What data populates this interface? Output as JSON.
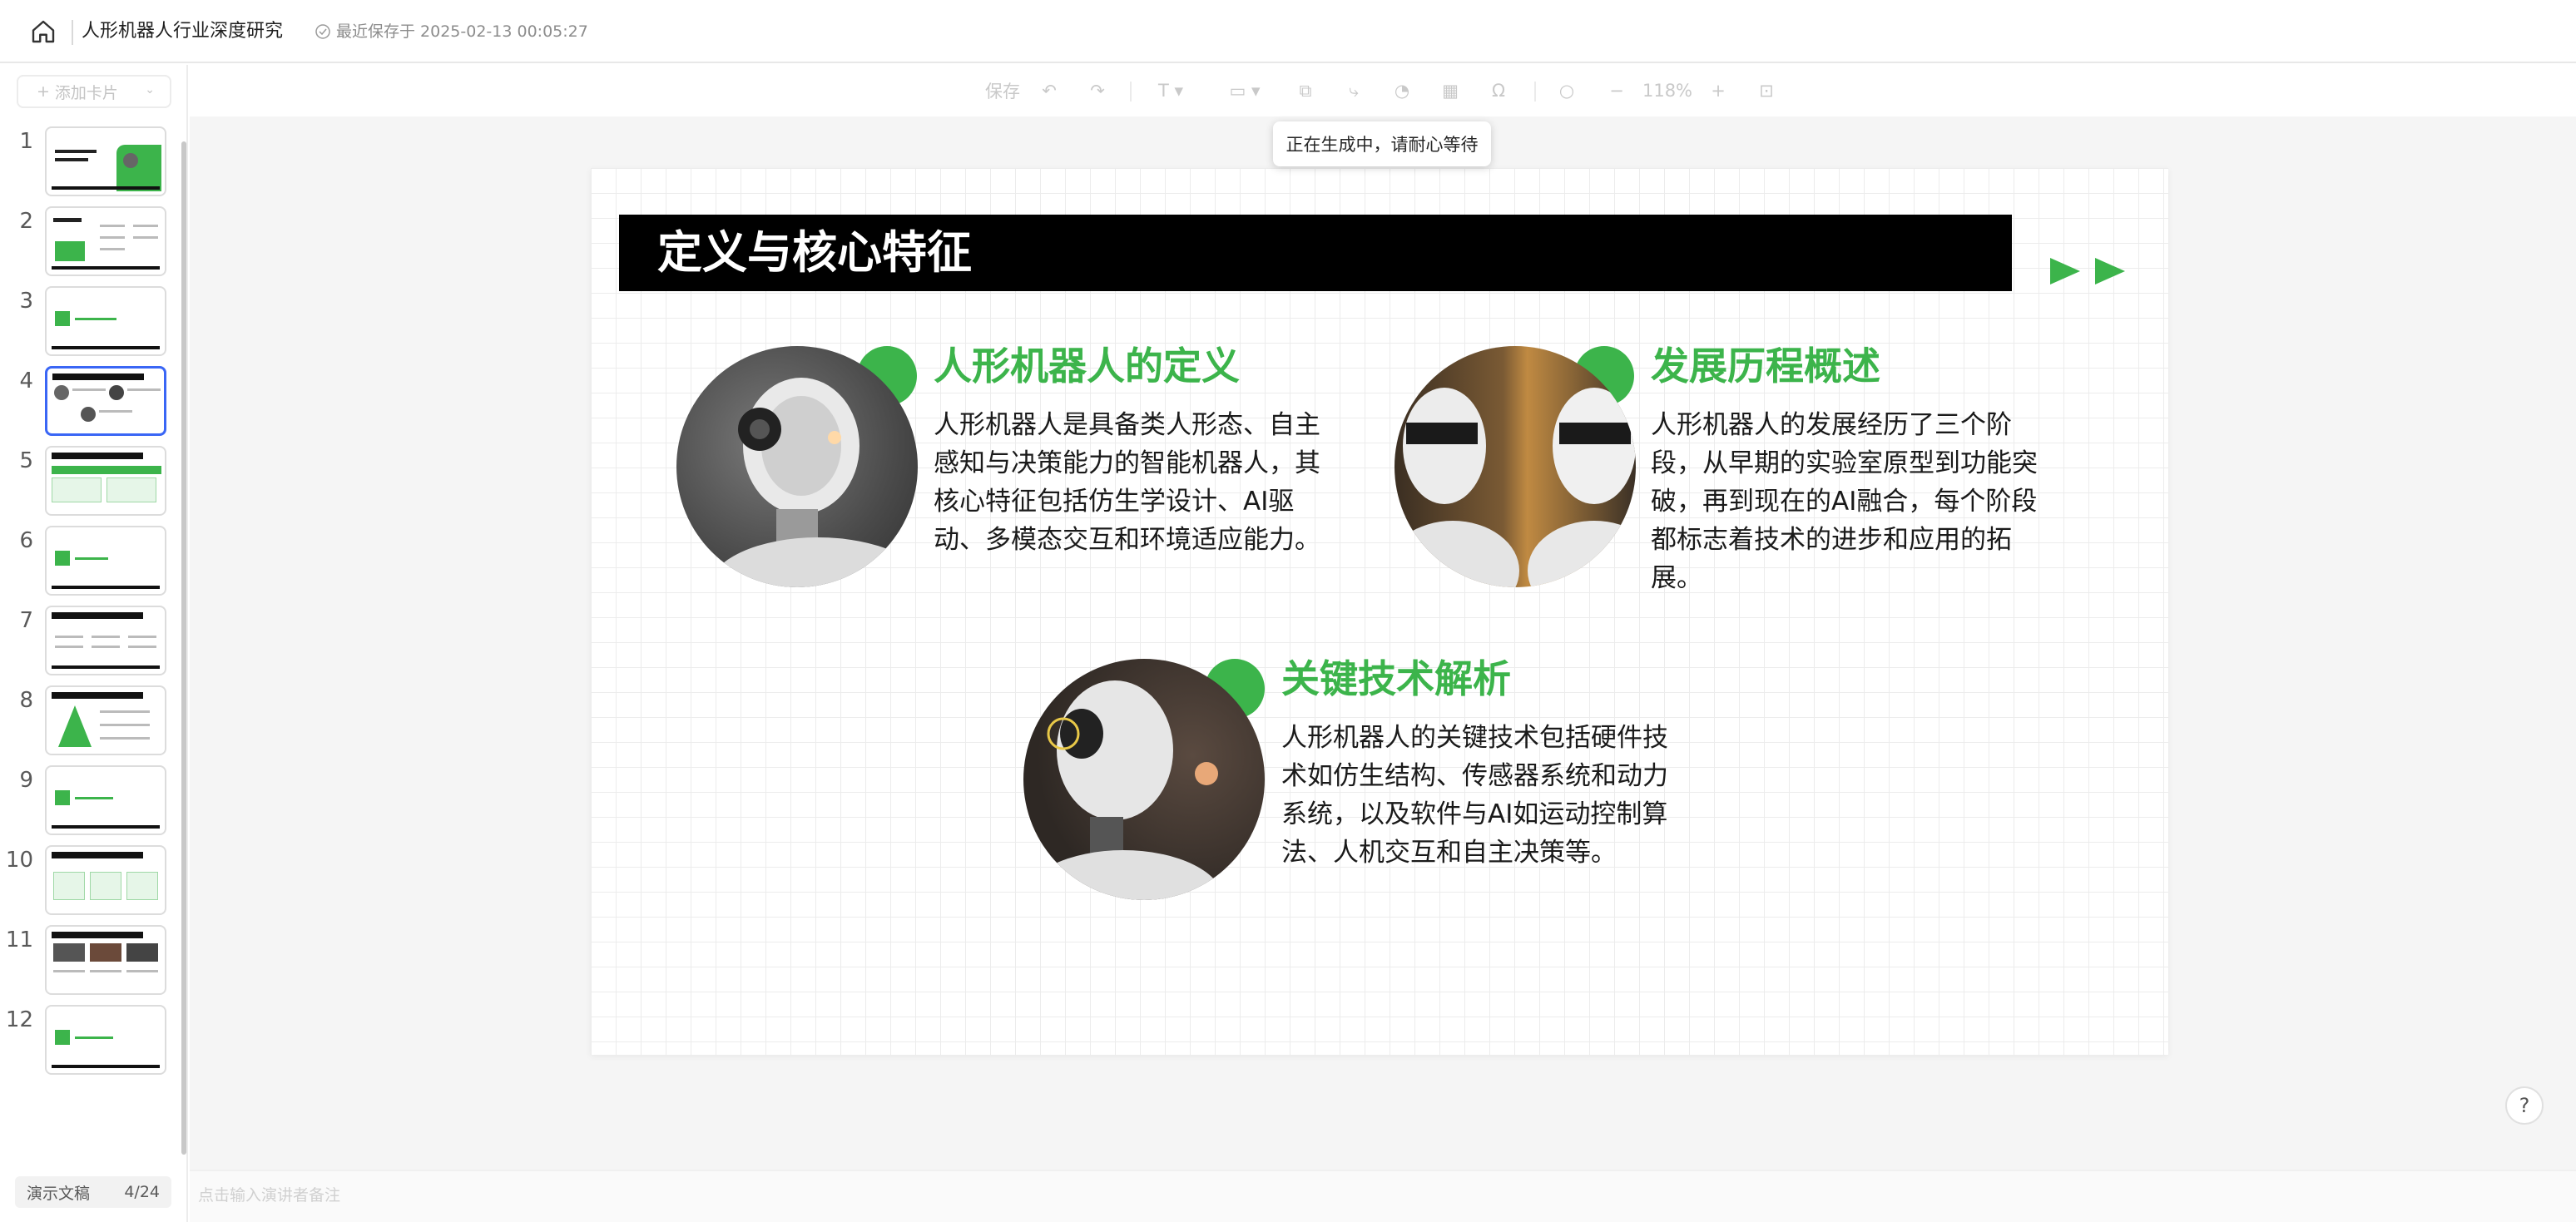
{
  "header": {
    "doc_title": "人形机器人行业深度研究",
    "save_status": "最近保存于 2025-02-13 00:05:27"
  },
  "sidebar": {
    "add_card_label": "添加卡片",
    "slides": [
      {
        "num": "1"
      },
      {
        "num": "2"
      },
      {
        "num": "3"
      },
      {
        "num": "4"
      },
      {
        "num": "5"
      },
      {
        "num": "6"
      },
      {
        "num": "7"
      },
      {
        "num": "8"
      },
      {
        "num": "9"
      },
      {
        "num": "10"
      },
      {
        "num": "11"
      },
      {
        "num": "12"
      }
    ],
    "active_slide": 4,
    "mode_label": "演示文稿",
    "page_counter": "4/24"
  },
  "toolbar": {
    "save_label": "保存",
    "zoom_label": "118%"
  },
  "tooltip": "正在生成中，请耐心等待",
  "slide": {
    "title": "定义与核心特征",
    "blocks": [
      {
        "title": "人形机器人的定义",
        "body": "人形机器人是具备类人形态、自主感知与决策能力的智能机器人，其核心特征包括仿生学设计、AI驱动、多模态交互和环境适应能力。"
      },
      {
        "title": "发展历程概述",
        "body": "人形机器人的发展经历了三个阶段，从早期的实验室原型到功能突破，再到现在的AI融合，每个阶段都标志着技术的进步和应用的拓展。"
      },
      {
        "title": "关键技术解析",
        "body": "人形机器人的关键技术包括硬件技术如仿生结构、传感器系统和动力系统，以及软件与AI如运动控制算法、人机交互和自主决策等。"
      }
    ]
  },
  "notes_placeholder": "点击输入演讲者备注",
  "help_label": "?",
  "colors": {
    "accent_green": "#3cb44b",
    "title_bar": "#000000",
    "active_border": "#3a66f5"
  }
}
